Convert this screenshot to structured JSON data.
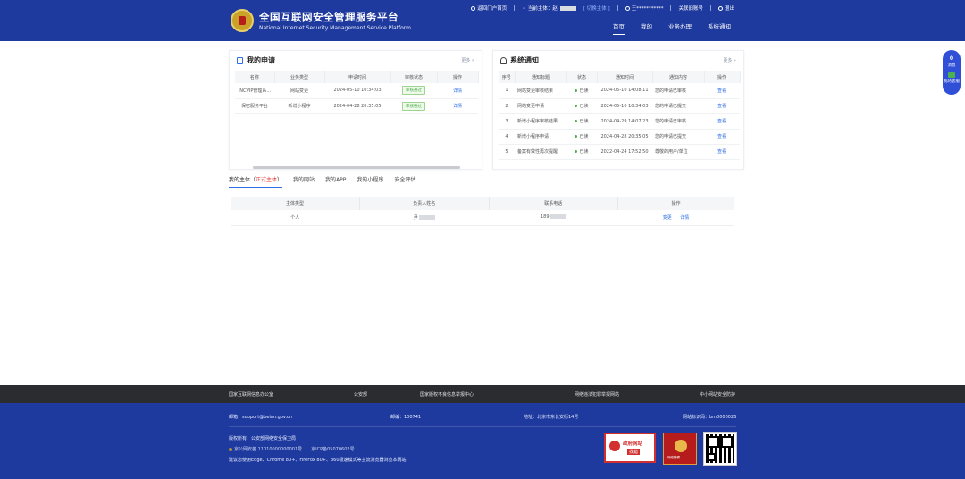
{
  "header": {
    "title": "全国互联网安全管理服务平台",
    "subtitle": "National Internet Security Management Service Platform",
    "topbar": {
      "back": "返回门户首页",
      "current_subject_label": "当前主体：赵",
      "switch_subject": "[ 切换主体 ]",
      "user": "王***********",
      "link_account": "关联旧账号",
      "logout": "退出"
    },
    "nav": [
      "首页",
      "我的",
      "业务办理",
      "系统通知"
    ]
  },
  "my_applications": {
    "title": "我的申请",
    "more": "更多 »",
    "columns": [
      "名称",
      "业务类型",
      "申请时间",
      "审核状态",
      "操作"
    ],
    "rows": [
      {
        "name": "INCVIP管理系...",
        "type": "网站变更",
        "time": "2024-05-10 10:34:03",
        "status": "审核通过",
        "action": "详情"
      },
      {
        "name": "保密服务平台",
        "type": "新增小程序",
        "time": "2024-04-28 20:35:05",
        "status": "审核通过",
        "action": "详情"
      }
    ]
  },
  "notifications": {
    "title": "系统通知",
    "more": "更多 »",
    "columns": [
      "序号",
      "通知标题",
      "状态",
      "通知时间",
      "通知内容",
      "操作"
    ],
    "rows": [
      {
        "no": "1",
        "title": "网站变更审核结果",
        "status": "已读",
        "time": "2024-05-10 14:08:11",
        "content": "您的申请已审核",
        "action": "查看"
      },
      {
        "no": "2",
        "title": "网站变更申请",
        "status": "已读",
        "time": "2024-05-10 10:34:03",
        "content": "您的申请已提交",
        "action": "查看"
      },
      {
        "no": "3",
        "title": "新增小程序审核结果",
        "status": "已读",
        "time": "2024-04-29 14:07:23",
        "content": "您的申请已审核",
        "action": "查看"
      },
      {
        "no": "4",
        "title": "新增小程序申请",
        "status": "已读",
        "time": "2024-04-28 20:35:05",
        "content": "您的申请已提交",
        "action": "查看"
      },
      {
        "no": "5",
        "title": "备案有效性再次提醒",
        "status": "已读",
        "time": "2022-04-24 17:52:50",
        "content": "尊敬的用户/单位",
        "action": "查看"
      }
    ]
  },
  "tabs": {
    "items": [
      "我的主体（",
      "正式主体",
      "）",
      "我的网站",
      "我的APP",
      "我的小程序",
      "安全评估"
    ]
  },
  "subject_table": {
    "columns": [
      "主体类型",
      "负责人姓名",
      "联系电话",
      "操作"
    ],
    "row": {
      "type": "个人",
      "name": "尹",
      "phone": "189",
      "action1": "变更",
      "action2": "详情"
    }
  },
  "float_widget": {
    "count": "0",
    "label1": "消息",
    "label2": "我的客服"
  },
  "footer": {
    "links": [
      "国家互联网信息办公室",
      "公安部",
      "国家版权不良信息举报中心",
      "网络违法犯罪举报网站",
      "中小网站安全防护"
    ],
    "email": "邮箱：support@beian.gov.cn",
    "postcode": "邮编：100741",
    "address": "地址：北京市东长安街14号",
    "icp": "网站标识码：bm0000026",
    "copyright": "版权所有：公安部网络安全保卫局",
    "beian1": "京公网安备 11010000000001号",
    "beian2": "京ICP备05070602号",
    "browser": "建议您使用Edge、Chrome 80+、FireFox 80+、360极速模式等主流浏览器浏览本网站",
    "gov_badge_line1": "政府网站",
    "gov_badge_line2": "找错",
    "police_badge": "网络警察"
  }
}
